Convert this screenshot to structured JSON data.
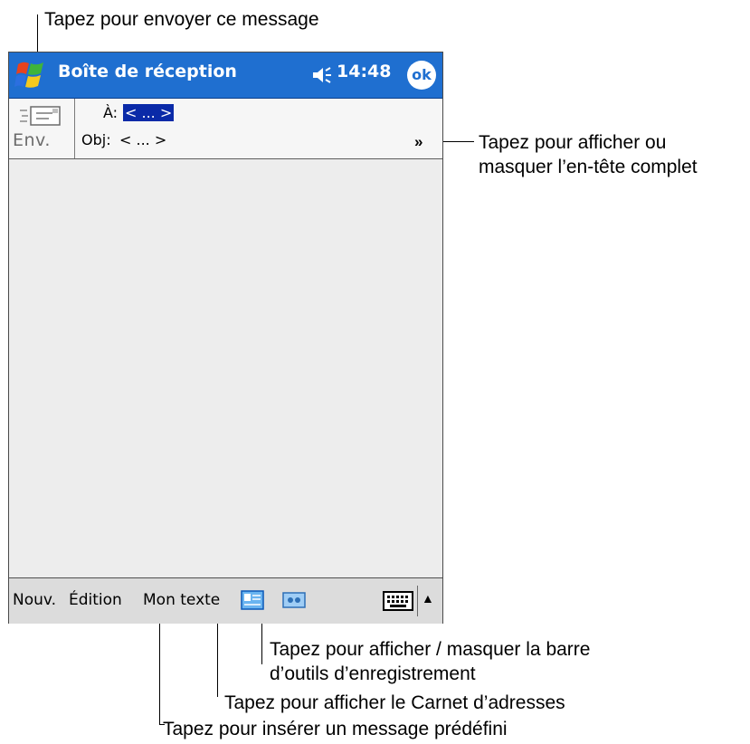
{
  "callouts": {
    "send": "Tapez pour envoyer ce message",
    "header_toggle_line1": "Tapez pour afficher ou",
    "header_toggle_line2": "masquer l’en-tête complet",
    "recording_line1": "Tapez pour afficher / masquer la barre",
    "recording_line2": "d’outils d’enregistrement",
    "address_book": "Tapez pour afficher le Carnet d’adresses",
    "my_text": "Tapez pour insérer un message prédéfini"
  },
  "titlebar": {
    "title": "Boîte de réception",
    "time": "14:48",
    "ok_label": "ok",
    "start_icon": "windows-flag-icon",
    "volume_icon": "speaker-icon"
  },
  "message_header": {
    "send_label": "Env.",
    "to_label": "À:",
    "to_value": "< ... >",
    "subject_label": "Obj:",
    "subject_value": "< ... >",
    "expand_icon": "double-chevron-down-icon"
  },
  "menubar": {
    "new_label": "Nouv.",
    "edit_label": "Édition",
    "my_text_label": "Mon texte",
    "address_book_icon": "address-book-icon",
    "recording_icon": "recording-toolbar-icon",
    "keyboard_icon": "keyboard-icon",
    "sip_arrow_icon": "triangle-up-icon"
  },
  "colors": {
    "titlebar": "#1f6fd0",
    "selection": "#0a2aa8",
    "screen_bg": "#ededed"
  }
}
